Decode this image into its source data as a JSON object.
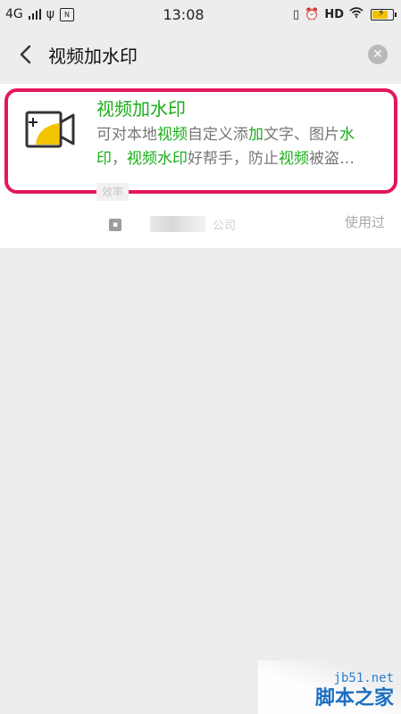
{
  "status_bar": {
    "network": "4G",
    "time": "13:08",
    "hd": "HD",
    "icons": [
      "signal-icon",
      "usb-icon",
      "nfc-icon",
      "vibrate-icon",
      "alarm-icon",
      "wifi-icon",
      "battery-icon"
    ]
  },
  "search": {
    "query": "视频加水印"
  },
  "result": {
    "title": "视频加水印",
    "desc_line1_parts": [
      "可对本地",
      "视频",
      "自定义添",
      "加",
      "文字、图片",
      "水"
    ],
    "desc_line2_parts": [
      "印",
      "，",
      "视频",
      "水印",
      "好帮手，防止",
      "视频",
      "被盗…"
    ],
    "tag": "效率",
    "company": "公司",
    "used_label": "使用过"
  },
  "watermark": {
    "url": "jb51.net",
    "name": "脚本之家"
  },
  "colors": {
    "accent_green": "#1aad19",
    "highlight_frame": "#e3175a",
    "background": "#ededed"
  }
}
